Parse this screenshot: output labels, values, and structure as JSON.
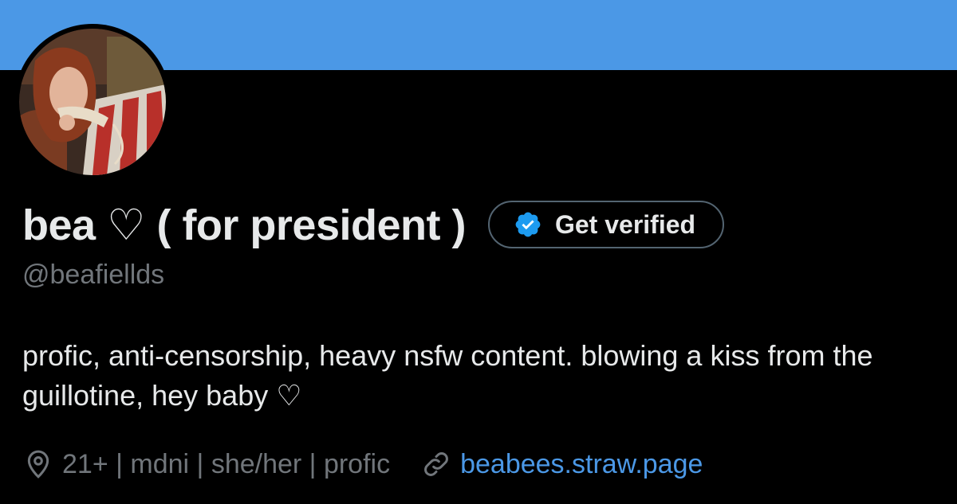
{
  "profile": {
    "display_name": "bea ♡ ( for president )",
    "handle": "@beafiellds",
    "bio": "profic, anti-censorship, heavy nsfw content. blowing a kiss from the guillotine, hey baby ♡",
    "location": "21+ | mdni | she/her | profic",
    "website": "beabees.straw.page"
  },
  "verify_button": {
    "label": "Get verified",
    "icon": "verified-badge-icon"
  },
  "icons": {
    "location": "location-pin-icon",
    "link": "link-icon"
  },
  "colors": {
    "banner": "#4b98e6",
    "background": "#000000",
    "primary_text": "#e7e9ea",
    "secondary_text": "#71767b",
    "link": "#4b98e6",
    "verified_badge": "#1d9bf0"
  }
}
